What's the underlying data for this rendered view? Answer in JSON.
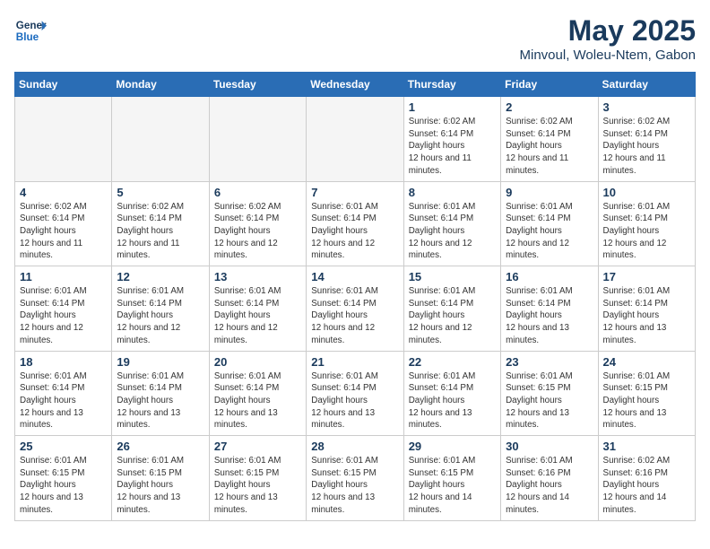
{
  "header": {
    "logo_line1": "General",
    "logo_line2": "Blue",
    "month_year": "May 2025",
    "location": "Minvoul, Woleu-Ntem, Gabon"
  },
  "weekdays": [
    "Sunday",
    "Monday",
    "Tuesday",
    "Wednesday",
    "Thursday",
    "Friday",
    "Saturday"
  ],
  "weeks": [
    [
      {
        "day": "",
        "empty": true
      },
      {
        "day": "",
        "empty": true
      },
      {
        "day": "",
        "empty": true
      },
      {
        "day": "",
        "empty": true
      },
      {
        "day": "1",
        "sunrise": "6:02 AM",
        "sunset": "6:14 PM",
        "daylight": "12 hours and 11 minutes."
      },
      {
        "day": "2",
        "sunrise": "6:02 AM",
        "sunset": "6:14 PM",
        "daylight": "12 hours and 11 minutes."
      },
      {
        "day": "3",
        "sunrise": "6:02 AM",
        "sunset": "6:14 PM",
        "daylight": "12 hours and 11 minutes."
      }
    ],
    [
      {
        "day": "4",
        "sunrise": "6:02 AM",
        "sunset": "6:14 PM",
        "daylight": "12 hours and 11 minutes."
      },
      {
        "day": "5",
        "sunrise": "6:02 AM",
        "sunset": "6:14 PM",
        "daylight": "12 hours and 11 minutes."
      },
      {
        "day": "6",
        "sunrise": "6:02 AM",
        "sunset": "6:14 PM",
        "daylight": "12 hours and 12 minutes."
      },
      {
        "day": "7",
        "sunrise": "6:01 AM",
        "sunset": "6:14 PM",
        "daylight": "12 hours and 12 minutes."
      },
      {
        "day": "8",
        "sunrise": "6:01 AM",
        "sunset": "6:14 PM",
        "daylight": "12 hours and 12 minutes."
      },
      {
        "day": "9",
        "sunrise": "6:01 AM",
        "sunset": "6:14 PM",
        "daylight": "12 hours and 12 minutes."
      },
      {
        "day": "10",
        "sunrise": "6:01 AM",
        "sunset": "6:14 PM",
        "daylight": "12 hours and 12 minutes."
      }
    ],
    [
      {
        "day": "11",
        "sunrise": "6:01 AM",
        "sunset": "6:14 PM",
        "daylight": "12 hours and 12 minutes."
      },
      {
        "day": "12",
        "sunrise": "6:01 AM",
        "sunset": "6:14 PM",
        "daylight": "12 hours and 12 minutes."
      },
      {
        "day": "13",
        "sunrise": "6:01 AM",
        "sunset": "6:14 PM",
        "daylight": "12 hours and 12 minutes."
      },
      {
        "day": "14",
        "sunrise": "6:01 AM",
        "sunset": "6:14 PM",
        "daylight": "12 hours and 12 minutes."
      },
      {
        "day": "15",
        "sunrise": "6:01 AM",
        "sunset": "6:14 PM",
        "daylight": "12 hours and 12 minutes."
      },
      {
        "day": "16",
        "sunrise": "6:01 AM",
        "sunset": "6:14 PM",
        "daylight": "12 hours and 13 minutes."
      },
      {
        "day": "17",
        "sunrise": "6:01 AM",
        "sunset": "6:14 PM",
        "daylight": "12 hours and 13 minutes."
      }
    ],
    [
      {
        "day": "18",
        "sunrise": "6:01 AM",
        "sunset": "6:14 PM",
        "daylight": "12 hours and 13 minutes."
      },
      {
        "day": "19",
        "sunrise": "6:01 AM",
        "sunset": "6:14 PM",
        "daylight": "12 hours and 13 minutes."
      },
      {
        "day": "20",
        "sunrise": "6:01 AM",
        "sunset": "6:14 PM",
        "daylight": "12 hours and 13 minutes."
      },
      {
        "day": "21",
        "sunrise": "6:01 AM",
        "sunset": "6:14 PM",
        "daylight": "12 hours and 13 minutes."
      },
      {
        "day": "22",
        "sunrise": "6:01 AM",
        "sunset": "6:14 PM",
        "daylight": "12 hours and 13 minutes."
      },
      {
        "day": "23",
        "sunrise": "6:01 AM",
        "sunset": "6:15 PM",
        "daylight": "12 hours and 13 minutes."
      },
      {
        "day": "24",
        "sunrise": "6:01 AM",
        "sunset": "6:15 PM",
        "daylight": "12 hours and 13 minutes."
      }
    ],
    [
      {
        "day": "25",
        "sunrise": "6:01 AM",
        "sunset": "6:15 PM",
        "daylight": "12 hours and 13 minutes."
      },
      {
        "day": "26",
        "sunrise": "6:01 AM",
        "sunset": "6:15 PM",
        "daylight": "12 hours and 13 minutes."
      },
      {
        "day": "27",
        "sunrise": "6:01 AM",
        "sunset": "6:15 PM",
        "daylight": "12 hours and 13 minutes."
      },
      {
        "day": "28",
        "sunrise": "6:01 AM",
        "sunset": "6:15 PM",
        "daylight": "12 hours and 13 minutes."
      },
      {
        "day": "29",
        "sunrise": "6:01 AM",
        "sunset": "6:15 PM",
        "daylight": "12 hours and 14 minutes."
      },
      {
        "day": "30",
        "sunrise": "6:01 AM",
        "sunset": "6:16 PM",
        "daylight": "12 hours and 14 minutes."
      },
      {
        "day": "31",
        "sunrise": "6:02 AM",
        "sunset": "6:16 PM",
        "daylight": "12 hours and 14 minutes."
      }
    ]
  ]
}
